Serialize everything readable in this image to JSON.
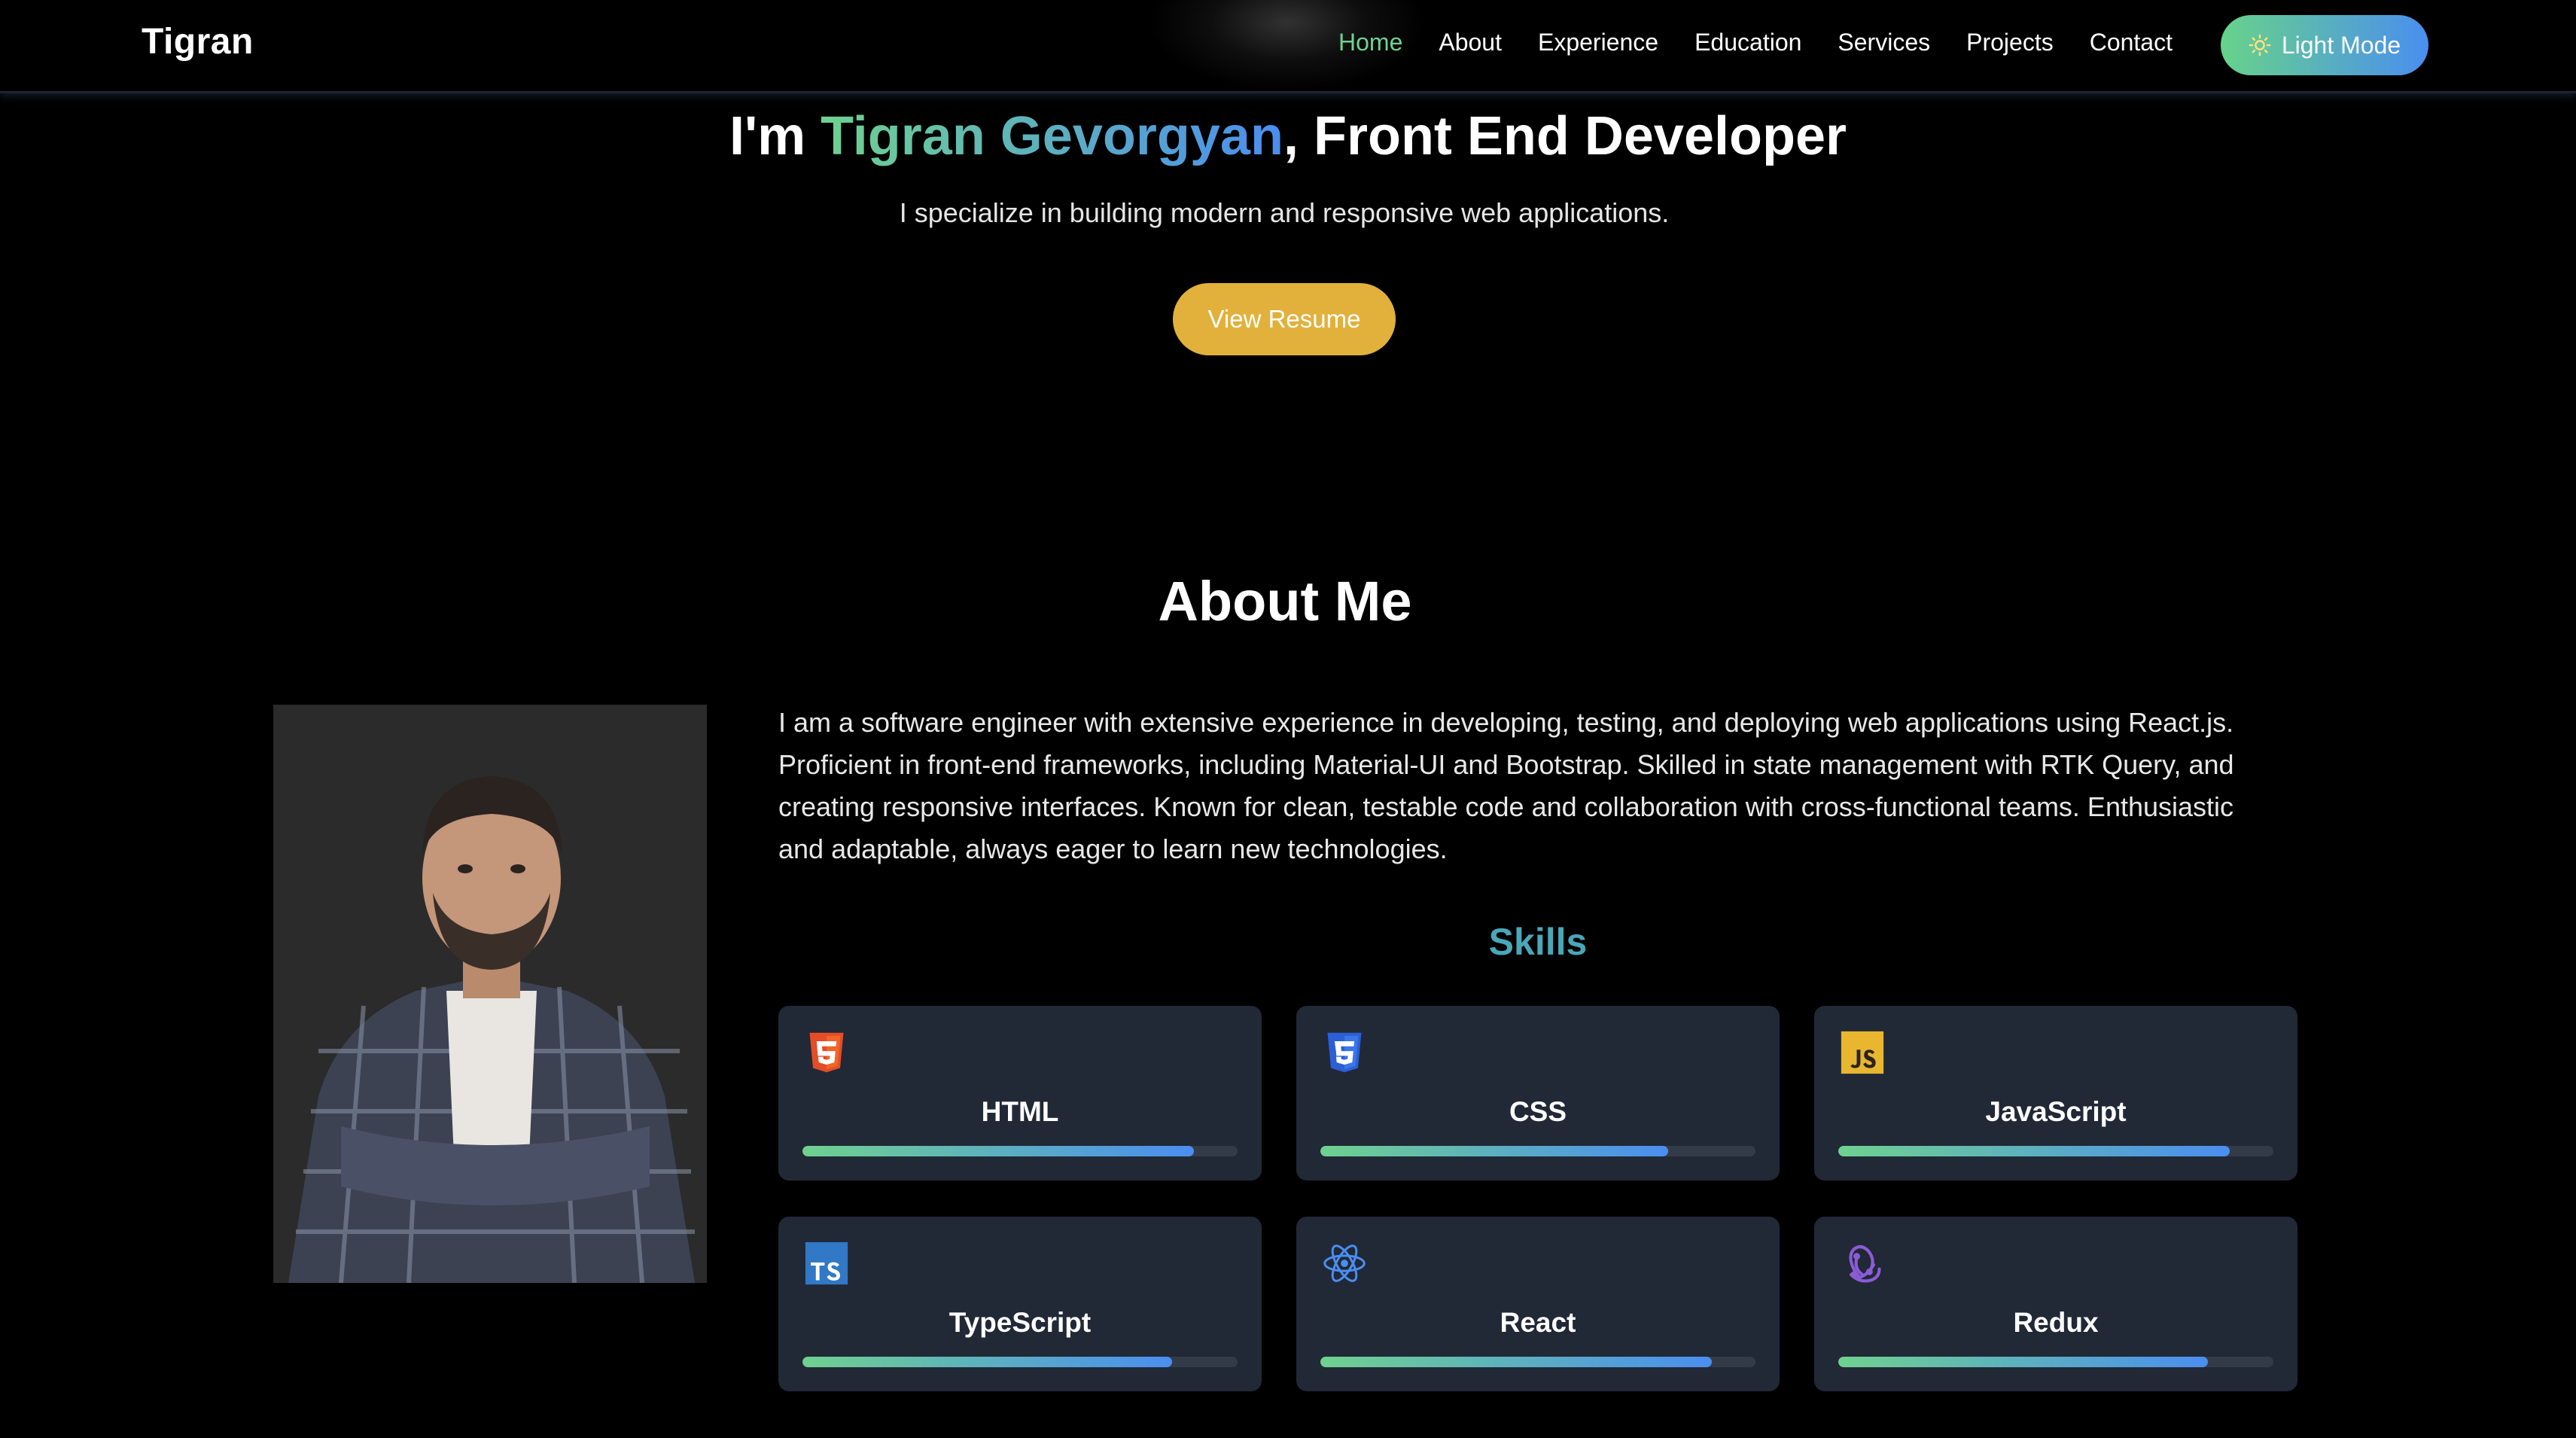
{
  "nav": {
    "brand": "Tigran",
    "links": [
      {
        "label": "Home",
        "active": true
      },
      {
        "label": "About",
        "active": false
      },
      {
        "label": "Experience",
        "active": false
      },
      {
        "label": "Education",
        "active": false
      },
      {
        "label": "Services",
        "active": false
      },
      {
        "label": "Projects",
        "active": false
      },
      {
        "label": "Contact",
        "active": false
      }
    ],
    "mode_button": {
      "label": "Light Mode",
      "icon": "sun-icon"
    }
  },
  "hero": {
    "title_prefix": "I'm ",
    "name": "Tigran Gevorgyan",
    "title_suffix": ", Front End Developer",
    "subtitle": "I specialize in building modern and responsive web applications.",
    "resume_label": "View Resume"
  },
  "about": {
    "title": "About Me",
    "text": "I am a software engineer with extensive experience in developing, testing, and deploying web applications using React.js. Proficient in front-end frameworks, including Material-UI and Bootstrap. Skilled in state management with RTK Query, and creating responsive interfaces. Known for clean, testable code and collaboration with cross-functional teams. Enthusiastic and adaptable, always eager to learn new technologies.",
    "skills_title": "Skills",
    "skills": [
      {
        "name": "HTML",
        "icon": "html5-icon",
        "level": 0.9
      },
      {
        "name": "CSS",
        "icon": "css3-icon",
        "level": 0.8
      },
      {
        "name": "JavaScript",
        "icon": "javascript-icon",
        "level": 0.9
      },
      {
        "name": "TypeScript",
        "icon": "typescript-icon",
        "level": 0.85
      },
      {
        "name": "React",
        "icon": "react-icon",
        "level": 0.9
      },
      {
        "name": "Redux",
        "icon": "redux-icon",
        "level": 0.85
      }
    ]
  },
  "colors": {
    "accent_green": "#6fd18f",
    "accent_blue": "#4a8ef0",
    "resume_button": "#e2b13c",
    "skills_heading": "#4aa7b9",
    "card_background": "#212836"
  }
}
